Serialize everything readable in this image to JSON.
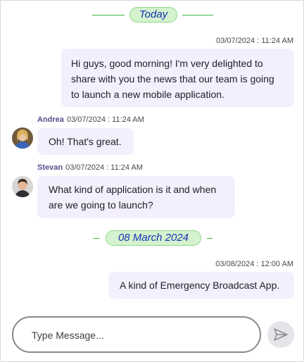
{
  "separators": [
    {
      "label": "Today"
    },
    {
      "label": "08 March 2024"
    }
  ],
  "messages": [
    {
      "timestamp": "03/07/2024 : 11:24 AM",
      "lines": [
        "Hi guys, good morning! I'm very delighted to",
        "share with you the news that our team is going",
        "to launch a new mobile application."
      ]
    },
    {
      "author": "Andrea",
      "timestamp": "03/07/2024 : 11:24 AM",
      "lines": [
        "Oh! That's great."
      ]
    },
    {
      "author": "Stevan",
      "timestamp": "03/07/2024 : 11:24 AM",
      "lines": [
        "What kind of application is it and when",
        "are we going to launch?"
      ]
    },
    {
      "timestamp": "03/08/2024 : 12:00 AM",
      "lines": [
        "A kind of Emergency Broadcast App."
      ]
    }
  ],
  "composer": {
    "placeholder": "Type Message...",
    "value": ""
  },
  "icons": {
    "send": "send-icon",
    "avatar_andrea": "avatar",
    "avatar_stevan": "avatar"
  },
  "colors": {
    "bubble": "#f3effd",
    "separator_pill": "#d3f2cd",
    "separator_text": "#1c2fb8",
    "author": "#5a4e8c"
  }
}
